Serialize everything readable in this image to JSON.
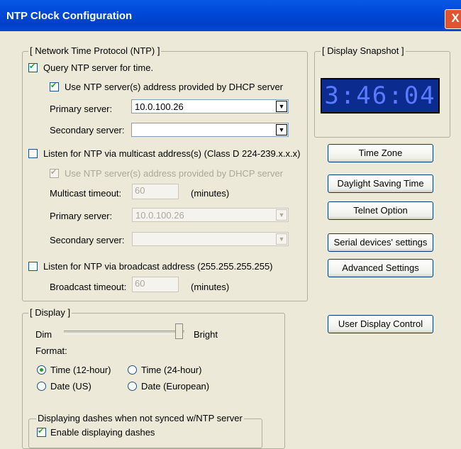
{
  "window": {
    "title": "NTP Clock Configuration",
    "close_glyph": "X"
  },
  "ntp": {
    "legend": "[ Network Time Protocol (NTP) ]",
    "query": {
      "label": "Query NTP server for time.",
      "checked": true
    },
    "use_dhcp": {
      "label": "Use NTP server(s) address  provided by DHCP server",
      "checked": true
    },
    "primary_label": "Primary server:",
    "primary_value": "10.0.100.26",
    "secondary_label": "Secondary server:",
    "secondary_value": "",
    "multicast": {
      "label": "Listen for NTP via multicast address(s) (Class D 224-239.x.x.x)",
      "checked": false
    },
    "mc_use_dhcp": {
      "label": "Use NTP server(s) address  provided by DHCP server",
      "checked": true
    },
    "mc_timeout_label": "Multicast timeout:",
    "mc_timeout_value": "60",
    "mc_timeout_unit": "(minutes)",
    "mc_primary_label": "Primary server:",
    "mc_primary_value": "10.0.100.26",
    "mc_secondary_label": "Secondary server:",
    "mc_secondary_value": "",
    "broadcast": {
      "label": "Listen for NTP via broadcast address (255.255.255.255)",
      "checked": false
    },
    "bc_timeout_label": "Broadcast timeout:",
    "bc_timeout_value": "60",
    "bc_timeout_unit": "(minutes)"
  },
  "snapshot": {
    "legend": "[ Display Snapshot ]",
    "time": "3:46:04"
  },
  "buttons": {
    "time_zone": "Time Zone",
    "dst": "Daylight Saving Time",
    "telnet": "Telnet Option",
    "serial": "Serial devices' settings",
    "advanced": "Advanced Settings",
    "user_display": "User Display Control"
  },
  "display": {
    "legend": "[ Display ]",
    "dim": "Dim",
    "bright": "Bright",
    "brightness_level": 1.0,
    "format_label": "Format:",
    "formats": [
      {
        "label": "Time (12-hour)",
        "selected": true
      },
      {
        "label": "Time (24-hour)",
        "selected": false
      },
      {
        "label": "Date (US)",
        "selected": false
      },
      {
        "label": "Date (European)",
        "selected": false
      }
    ],
    "dashes_legend": "Displaying dashes when not synced w/NTP server",
    "enable_dashes": {
      "label": "Enable displaying dashes",
      "checked": true
    }
  }
}
